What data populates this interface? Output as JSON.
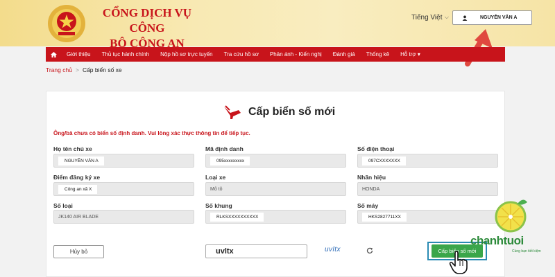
{
  "header": {
    "title_line1": "CỔNG DỊCH VỤ CÔNG",
    "title_line2": "BỘ CÔNG AN",
    "language": "Tiếng Việt",
    "user_name": "NGUYỄN VĂN A"
  },
  "nav": {
    "items": [
      "Giới thiệu",
      "Thủ tục hành chính",
      "Nộp hồ sơ trực tuyến",
      "Tra cứu hồ sơ",
      "Phản ánh - Kiến nghị",
      "Đánh giá",
      "Thống kê",
      "Hỗ trợ ▾"
    ]
  },
  "breadcrumb": {
    "home": "Trang chủ",
    "separator": ">",
    "current": "Cấp biển số xe"
  },
  "form": {
    "title": "Cấp biển số mới",
    "warning": "Ông/bà chưa có biển số định danh. Vui lòng xác thực thông tin để tiếp tục.",
    "fields": [
      {
        "label": "Họ tên chủ xe",
        "value": "NGUYỄN VĂN A"
      },
      {
        "label": "Mã định danh",
        "value": "095xxxxxxxxx"
      },
      {
        "label": "Số điện thoại",
        "value": "097CXXXXXXX"
      },
      {
        "label": "Điểm đăng ký xe",
        "value": "Công an xã X"
      },
      {
        "label": "Loại xe",
        "value": "Mô tô"
      },
      {
        "label": "Nhãn hiệu",
        "value": "HONDA"
      },
      {
        "label": "Số loại",
        "value": "JK140 AIR BLADE"
      },
      {
        "label": "Số khung",
        "value": "RLKSXXXXXXXXXX"
      },
      {
        "label": "Số máy",
        "value": "HKS2827711XX"
      }
    ],
    "cancel_label": "Hủy bỏ",
    "captcha_value": "uvltx",
    "captcha_image_text": "uvltx",
    "submit_label": "Cấp biển số mới"
  },
  "watermark": {
    "brand": "chanhtuoi",
    "tagline": "Cùng bạn tiết kiệm"
  },
  "colors": {
    "brand_red": "#c8141b",
    "submit_green": "#3aa64a",
    "header_gold": "#f6e4a6"
  }
}
